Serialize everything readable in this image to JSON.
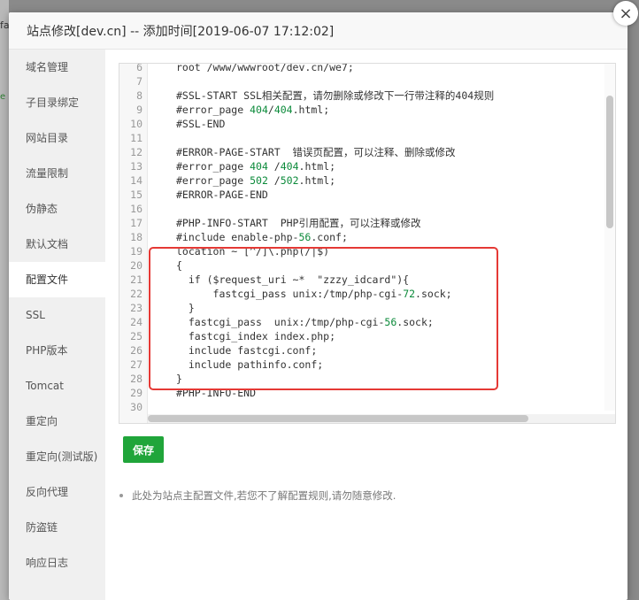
{
  "background": {
    "text_top": "fa",
    "text_side": "e"
  },
  "dialog": {
    "title": "站点修改[dev.cn] -- 添加时间[2019-06-07 17:12:02]",
    "close_label": "×"
  },
  "sidebar": {
    "items": [
      {
        "label": "域名管理"
      },
      {
        "label": "子目录绑定"
      },
      {
        "label": "网站目录"
      },
      {
        "label": "流量限制"
      },
      {
        "label": "伪静态"
      },
      {
        "label": "默认文档"
      },
      {
        "label": "配置文件"
      },
      {
        "label": "SSL"
      },
      {
        "label": "PHP版本"
      },
      {
        "label": "Tomcat"
      },
      {
        "label": "重定向"
      },
      {
        "label": "重定向(测试版)"
      },
      {
        "label": "反向代理"
      },
      {
        "label": "防盗链"
      },
      {
        "label": "响应日志"
      }
    ],
    "active_label": "配置文件"
  },
  "editor": {
    "lines": [
      {
        "n": "6",
        "text": "root /www/wwwroot/dev.cn/we7;"
      },
      {
        "n": "7",
        "text": ""
      },
      {
        "n": "8",
        "text": "#SSL-START SSL相关配置，请勿删除或修改下一行带注释的404规则"
      },
      {
        "n": "9",
        "text": "#error_page 404/404.html;"
      },
      {
        "n": "10",
        "text": "#SSL-END"
      },
      {
        "n": "11",
        "text": ""
      },
      {
        "n": "12",
        "text": "#ERROR-PAGE-START  错误页配置，可以注释、删除或修改"
      },
      {
        "n": "13",
        "text": "#error_page 404 /404.html;"
      },
      {
        "n": "14",
        "text": "#error_page 502 /502.html;"
      },
      {
        "n": "15",
        "text": "#ERROR-PAGE-END"
      },
      {
        "n": "16",
        "text": ""
      },
      {
        "n": "17",
        "text": "#PHP-INFO-START  PHP引用配置，可以注释或修改"
      },
      {
        "n": "18",
        "text": "#include enable-php-56.conf;"
      },
      {
        "n": "19",
        "text": "location ~ [^/]\\.php(/|$)"
      },
      {
        "n": "20",
        "text": "{"
      },
      {
        "n": "21",
        "text": "  if ($request_uri ~*  \"zzzy_idcard\"){"
      },
      {
        "n": "22",
        "text": "      fastcgi_pass unix:/tmp/php-cgi-72.sock;"
      },
      {
        "n": "23",
        "text": "  }"
      },
      {
        "n": "24",
        "text": "  fastcgi_pass  unix:/tmp/php-cgi-56.sock;"
      },
      {
        "n": "25",
        "text": "  fastcgi_index index.php;"
      },
      {
        "n": "26",
        "text": "  include fastcgi.conf;"
      },
      {
        "n": "27",
        "text": "  include pathinfo.conf;"
      },
      {
        "n": "28",
        "text": "}"
      },
      {
        "n": "29",
        "text": "#PHP-INFO-END"
      },
      {
        "n": "30",
        "text": ""
      }
    ]
  },
  "actions": {
    "save_label": "保存"
  },
  "tip": "此处为站点主配置文件,若您不了解配置规则,请勿随意修改.",
  "colors": {
    "accent": "#20a53a",
    "highlight": "#e53935",
    "number": "#0b8a3a"
  }
}
